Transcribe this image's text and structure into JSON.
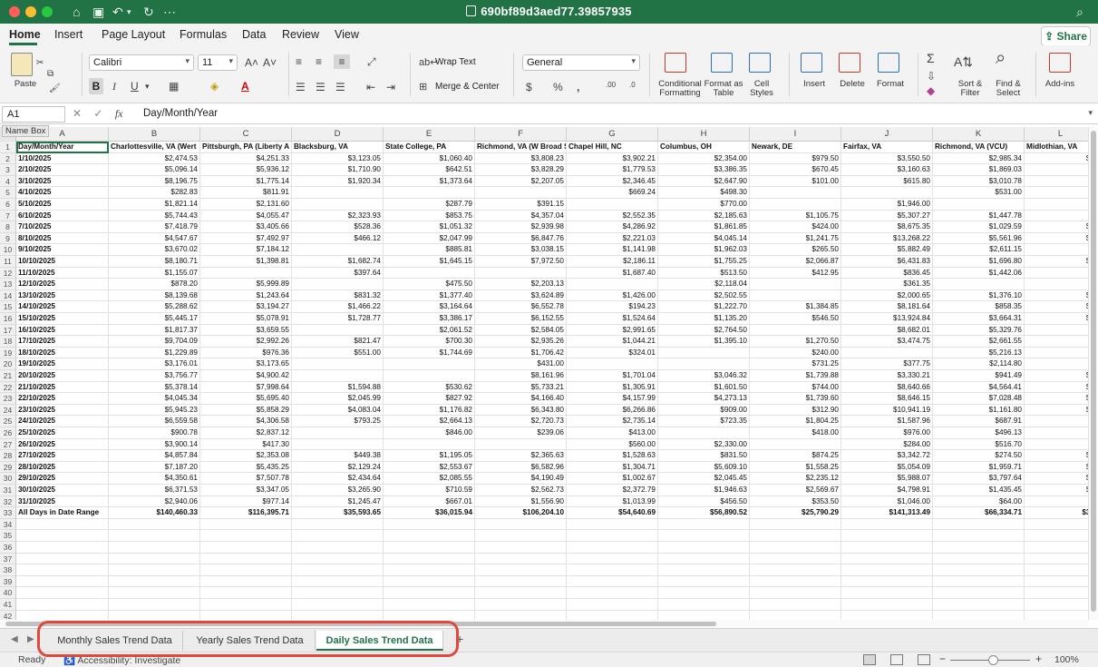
{
  "window": {
    "title": "690bf89d3aed77.39857935"
  },
  "ribbon_tabs": [
    "Home",
    "Insert",
    "Page Layout",
    "Formulas",
    "Data",
    "Review",
    "View"
  ],
  "share_label": "Share",
  "ribbon": {
    "paste": "Paste",
    "font_name": "Calibri",
    "font_size": "11",
    "bold": "B",
    "italic": "I",
    "underline": "U",
    "wrap_text": "Wrap Text",
    "merge_center": "Merge & Center",
    "number_format": "General",
    "conditional_formatting": "Conditional Formatting",
    "format_as_table": "Format as Table",
    "cell_styles": "Cell Styles",
    "insert": "Insert",
    "delete": "Delete",
    "format": "Format",
    "sort_filter": "Sort & Filter",
    "find_select": "Find & Select",
    "addins": "Add-ins"
  },
  "formula_bar": {
    "name_box": "A1",
    "formula": "Day/Month/Year",
    "name_box_tooltip": "Name Box"
  },
  "columns": [
    "A",
    "B",
    "C",
    "D",
    "E",
    "F",
    "G",
    "H",
    "I",
    "J",
    "K",
    "L"
  ],
  "header_row": [
    "Day/Month/Year",
    "Charlottesville, VA (Wert",
    "Pittsburgh, PA (Liberty A",
    "Blacksburg, VA",
    "State College, PA",
    "Richmond, VA (W Broad S",
    "Chapel Hill, NC",
    "Columbus, OH",
    "Newark, DE",
    "Fairfax, VA",
    "Richmond, VA (VCU)",
    "Midlothian, VA"
  ],
  "rows": [
    [
      "1/10/2025",
      "$2,474.53",
      "$4,251.33",
      "$3,123.05",
      "$1,060.40",
      "$3,808.23",
      "$3,902.21",
      "$2,354.00",
      "$979.50",
      "$3,550.50",
      "$2,985.34",
      "$4"
    ],
    [
      "2/10/2025",
      "$5,096.14",
      "$5,936.12",
      "$1,710.90",
      "$642.51",
      "$3,828.29",
      "$1,779.53",
      "$3,386.35",
      "$670.45",
      "$3,160.63",
      "$1,869.03",
      "$"
    ],
    [
      "3/10/2025",
      "$8,196.75",
      "$1,775.14",
      "$1,920.34",
      "$1,373.64",
      "$2,207.05",
      "$2,346.45",
      "$2,647.90",
      "$101.00",
      "$615.80",
      "$3,010.78",
      "$"
    ],
    [
      "4/10/2025",
      "$282.83",
      "$811.91",
      "",
      "",
      "",
      "$669.24",
      "$498.30",
      "",
      "",
      "$531.00",
      ""
    ],
    [
      "5/10/2025",
      "$1,821.14",
      "$2,131.60",
      "",
      "$287.79",
      "$391.15",
      "",
      "$770.00",
      "",
      "$1,946.00",
      "",
      ""
    ],
    [
      "6/10/2025",
      "$5,744.43",
      "$4,055.47",
      "$2,323.93",
      "$853.75",
      "$4,357.04",
      "$2,552.35",
      "$2,185.63",
      "$1,105.75",
      "$5,307.27",
      "$1,447.78",
      "$"
    ],
    [
      "7/10/2025",
      "$7,418.79",
      "$3,405.66",
      "$528.36",
      "$1,051.32",
      "$2,939.98",
      "$4,286.92",
      "$1,861.85",
      "$424.00",
      "$8,675.35",
      "$1,029.59",
      "$2"
    ],
    [
      "8/10/2025",
      "$4,547.67",
      "$7,492.97",
      "$466.12",
      "$2,047.99",
      "$6,847.76",
      "$2,221.03",
      "$4,045.14",
      "$1,241.75",
      "$13,268.22",
      "$5,561.96",
      "$2"
    ],
    [
      "9/10/2025",
      "$3,670.02",
      "$7,184.12",
      "",
      "$885.81",
      "$3,038.15",
      "$1,141.98",
      "$1,962.03",
      "$265.50",
      "$5,882.49",
      "$2,611.15",
      "$"
    ],
    [
      "10/10/2025",
      "$8,180.71",
      "$1,398.81",
      "$1,682.74",
      "$1,645.15",
      "$7,972.50",
      "$2,186.11",
      "$1,755.25",
      "$2,066.87",
      "$6,431.83",
      "$1,696.80",
      "$1"
    ],
    [
      "11/10/2025",
      "$1,155.07",
      "",
      "$397.64",
      "",
      "",
      "$1,687.40",
      "$513.50",
      "$412.95",
      "$836.45",
      "$1,442.06",
      ""
    ],
    [
      "12/10/2025",
      "$878.20",
      "$5,999.89",
      "",
      "$475.50",
      "$2,203.13",
      "",
      "$2,118.04",
      "",
      "$361.35",
      "",
      ""
    ],
    [
      "13/10/2025",
      "$8,139.68",
      "$1,243.64",
      "$831.32",
      "$1,377.40",
      "$3,624.89",
      "$1,426.00",
      "$2,502.55",
      "",
      "$2,000.65",
      "$1,376.10",
      "$3"
    ],
    [
      "14/10/2025",
      "$5,288.62",
      "$3,194.27",
      "$1,466.22",
      "$3,164.64",
      "$6,552.78",
      "$194.23",
      "$1,222.70",
      "$1,384.85",
      "$8,181.64",
      "$858.35",
      "$1"
    ],
    [
      "15/10/2025",
      "$5,445.17",
      "$5,078.91",
      "$1,728.77",
      "$3,386.17",
      "$6,152.55",
      "$1,524.64",
      "$1,135.20",
      "$546.50",
      "$13,924.84",
      "$3,664.31",
      "$1"
    ],
    [
      "16/10/2025",
      "$1,817.37",
      "$3,659.55",
      "",
      "$2,061.52",
      "$2,584.05",
      "$2,991.65",
      "$2,764.50",
      "",
      "$8,682.01",
      "$5,329.76",
      "$"
    ],
    [
      "17/10/2025",
      "$9,704.09",
      "$2,992.26",
      "$821.47",
      "$700.30",
      "$2,935.26",
      "$1,044.21",
      "$1,395.10",
      "$1,270.50",
      "$3,474.75",
      "$2,661.55",
      "$"
    ],
    [
      "18/10/2025",
      "$1,229.89",
      "$976.36",
      "$551.00",
      "$1,744.69",
      "$1,706.42",
      "$324.01",
      "",
      "$240.00",
      "",
      "$5,216.13",
      ""
    ],
    [
      "19/10/2025",
      "$3,176.01",
      "$3,173.65",
      "",
      "",
      "$431.00",
      "",
      "",
      "$731.25",
      "$377.75",
      "$2,114.80",
      ""
    ],
    [
      "20/10/2025",
      "$3,756.77",
      "$4,900.42",
      "",
      "",
      "$8,161.96",
      "$1,701.04",
      "$3,046.32",
      "$1,739.88",
      "$3,330.21",
      "$941.49",
      "$1"
    ],
    [
      "21/10/2025",
      "$5,378.14",
      "$7,998.64",
      "$1,594.88",
      "$530.62",
      "$5,733.21",
      "$1,305.91",
      "$1,601.50",
      "$744.00",
      "$8,640.66",
      "$4,564.41",
      "$3"
    ],
    [
      "22/10/2025",
      "$4,045.34",
      "$5,695.40",
      "$2,045.99",
      "$827.92",
      "$4,166.40",
      "$4,157.99",
      "$4,273.13",
      "$1,739.60",
      "$8,646.15",
      "$7,028.48",
      "$1"
    ],
    [
      "23/10/2025",
      "$5,945.23",
      "$5,858.29",
      "$4,083.04",
      "$1,176.82",
      "$6,343.80",
      "$6,266.86",
      "$909.00",
      "$312.90",
      "$10,941.19",
      "$1,161.80",
      "$1"
    ],
    [
      "24/10/2025",
      "$6,559.58",
      "$4,306.58",
      "$793.25",
      "$2,664.13",
      "$2,720.73",
      "$2,735.14",
      "$723.35",
      "$1,804.25",
      "$1,587.96",
      "$687.91",
      ""
    ],
    [
      "25/10/2025",
      "$900.78",
      "$2,837.12",
      "",
      "$846.00",
      "$239.06",
      "$413.00",
      "",
      "$418.00",
      "$976.00",
      "$496.13",
      ""
    ],
    [
      "26/10/2025",
      "$3,900.14",
      "$417.30",
      "",
      "",
      "",
      "$560.00",
      "$2,330.00",
      "",
      "$284.00",
      "$516.70",
      ""
    ],
    [
      "27/10/2025",
      "$4,857.84",
      "$2,353.08",
      "$449.38",
      "$1,195.05",
      "$2,365.63",
      "$1,528.63",
      "$831.50",
      "$874.25",
      "$3,342.72",
      "$274.50",
      "$1"
    ],
    [
      "28/10/2025",
      "$7,187.20",
      "$5,435.25",
      "$2,129.24",
      "$2,553.67",
      "$6,582.96",
      "$1,304.71",
      "$5,609.10",
      "$1,558.25",
      "$5,054.09",
      "$1,959.71",
      "$1"
    ],
    [
      "29/10/2025",
      "$4,350.61",
      "$7,507.78",
      "$2,434.64",
      "$2,085.55",
      "$4,190.49",
      "$1,002.67",
      "$2,045.45",
      "$2,235.12",
      "$5,988.07",
      "$3,797.64",
      "$3"
    ],
    [
      "30/10/2025",
      "$6,371.53",
      "$3,347.05",
      "$3,265.90",
      "$710.59",
      "$2,562.73",
      "$2,372.79",
      "$1,946.63",
      "$2,569.67",
      "$4,798.91",
      "$1,435.45",
      "$1"
    ],
    [
      "31/10/2025",
      "$2,940.06",
      "$977.14",
      "$1,245.47",
      "$667.01",
      "$1,556.90",
      "$1,013.99",
      "$456.50",
      "$353.50",
      "$1,046.00",
      "$64.00",
      "$"
    ],
    [
      "All Days in Date Range",
      "$140,460.33",
      "$116,395.71",
      "$35,593.65",
      "$36,015.94",
      "$106,204.10",
      "$54,640.69",
      "$56,890.52",
      "$25,790.29",
      "$141,313.49",
      "$66,334.71",
      "$37"
    ]
  ],
  "empty_row_numbers": [
    34,
    35,
    36,
    37,
    38,
    39,
    40,
    41,
    42
  ],
  "sheet_tabs": [
    "Monthly Sales Trend Data",
    "Yearly Sales Trend Data",
    "Daily Sales Trend Data"
  ],
  "status": {
    "ready": "Ready",
    "accessibility": "Accessibility: Investigate",
    "zoom": "100%"
  }
}
